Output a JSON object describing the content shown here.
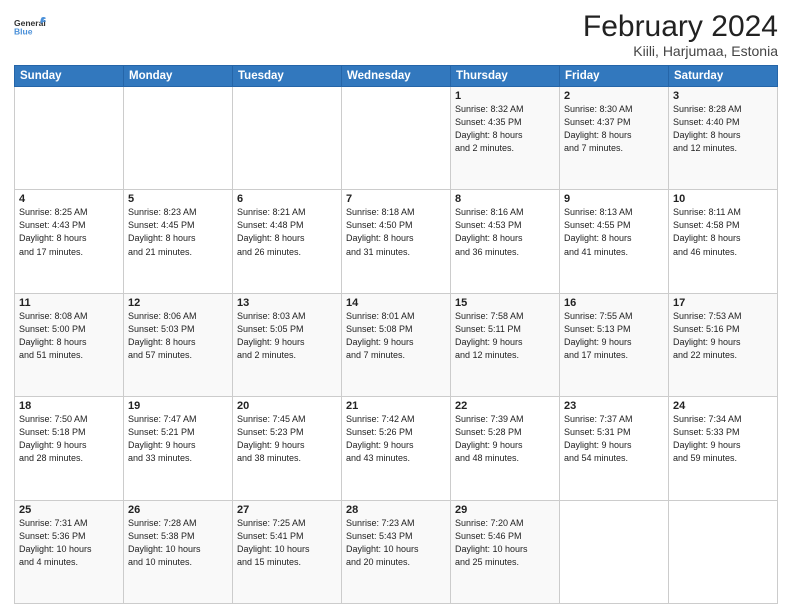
{
  "logo": {
    "line1": "General",
    "line2": "Blue"
  },
  "title": "February 2024",
  "subtitle": "Kiili, Harjumaa, Estonia",
  "days_header": [
    "Sunday",
    "Monday",
    "Tuesday",
    "Wednesday",
    "Thursday",
    "Friday",
    "Saturday"
  ],
  "weeks": [
    [
      {
        "num": "",
        "info": ""
      },
      {
        "num": "",
        "info": ""
      },
      {
        "num": "",
        "info": ""
      },
      {
        "num": "",
        "info": ""
      },
      {
        "num": "1",
        "info": "Sunrise: 8:32 AM\nSunset: 4:35 PM\nDaylight: 8 hours\nand 2 minutes."
      },
      {
        "num": "2",
        "info": "Sunrise: 8:30 AM\nSunset: 4:37 PM\nDaylight: 8 hours\nand 7 minutes."
      },
      {
        "num": "3",
        "info": "Sunrise: 8:28 AM\nSunset: 4:40 PM\nDaylight: 8 hours\nand 12 minutes."
      }
    ],
    [
      {
        "num": "4",
        "info": "Sunrise: 8:25 AM\nSunset: 4:43 PM\nDaylight: 8 hours\nand 17 minutes."
      },
      {
        "num": "5",
        "info": "Sunrise: 8:23 AM\nSunset: 4:45 PM\nDaylight: 8 hours\nand 21 minutes."
      },
      {
        "num": "6",
        "info": "Sunrise: 8:21 AM\nSunset: 4:48 PM\nDaylight: 8 hours\nand 26 minutes."
      },
      {
        "num": "7",
        "info": "Sunrise: 8:18 AM\nSunset: 4:50 PM\nDaylight: 8 hours\nand 31 minutes."
      },
      {
        "num": "8",
        "info": "Sunrise: 8:16 AM\nSunset: 4:53 PM\nDaylight: 8 hours\nand 36 minutes."
      },
      {
        "num": "9",
        "info": "Sunrise: 8:13 AM\nSunset: 4:55 PM\nDaylight: 8 hours\nand 41 minutes."
      },
      {
        "num": "10",
        "info": "Sunrise: 8:11 AM\nSunset: 4:58 PM\nDaylight: 8 hours\nand 46 minutes."
      }
    ],
    [
      {
        "num": "11",
        "info": "Sunrise: 8:08 AM\nSunset: 5:00 PM\nDaylight: 8 hours\nand 51 minutes."
      },
      {
        "num": "12",
        "info": "Sunrise: 8:06 AM\nSunset: 5:03 PM\nDaylight: 8 hours\nand 57 minutes."
      },
      {
        "num": "13",
        "info": "Sunrise: 8:03 AM\nSunset: 5:05 PM\nDaylight: 9 hours\nand 2 minutes."
      },
      {
        "num": "14",
        "info": "Sunrise: 8:01 AM\nSunset: 5:08 PM\nDaylight: 9 hours\nand 7 minutes."
      },
      {
        "num": "15",
        "info": "Sunrise: 7:58 AM\nSunset: 5:11 PM\nDaylight: 9 hours\nand 12 minutes."
      },
      {
        "num": "16",
        "info": "Sunrise: 7:55 AM\nSunset: 5:13 PM\nDaylight: 9 hours\nand 17 minutes."
      },
      {
        "num": "17",
        "info": "Sunrise: 7:53 AM\nSunset: 5:16 PM\nDaylight: 9 hours\nand 22 minutes."
      }
    ],
    [
      {
        "num": "18",
        "info": "Sunrise: 7:50 AM\nSunset: 5:18 PM\nDaylight: 9 hours\nand 28 minutes."
      },
      {
        "num": "19",
        "info": "Sunrise: 7:47 AM\nSunset: 5:21 PM\nDaylight: 9 hours\nand 33 minutes."
      },
      {
        "num": "20",
        "info": "Sunrise: 7:45 AM\nSunset: 5:23 PM\nDaylight: 9 hours\nand 38 minutes."
      },
      {
        "num": "21",
        "info": "Sunrise: 7:42 AM\nSunset: 5:26 PM\nDaylight: 9 hours\nand 43 minutes."
      },
      {
        "num": "22",
        "info": "Sunrise: 7:39 AM\nSunset: 5:28 PM\nDaylight: 9 hours\nand 48 minutes."
      },
      {
        "num": "23",
        "info": "Sunrise: 7:37 AM\nSunset: 5:31 PM\nDaylight: 9 hours\nand 54 minutes."
      },
      {
        "num": "24",
        "info": "Sunrise: 7:34 AM\nSunset: 5:33 PM\nDaylight: 9 hours\nand 59 minutes."
      }
    ],
    [
      {
        "num": "25",
        "info": "Sunrise: 7:31 AM\nSunset: 5:36 PM\nDaylight: 10 hours\nand 4 minutes."
      },
      {
        "num": "26",
        "info": "Sunrise: 7:28 AM\nSunset: 5:38 PM\nDaylight: 10 hours\nand 10 minutes."
      },
      {
        "num": "27",
        "info": "Sunrise: 7:25 AM\nSunset: 5:41 PM\nDaylight: 10 hours\nand 15 minutes."
      },
      {
        "num": "28",
        "info": "Sunrise: 7:23 AM\nSunset: 5:43 PM\nDaylight: 10 hours\nand 20 minutes."
      },
      {
        "num": "29",
        "info": "Sunrise: 7:20 AM\nSunset: 5:46 PM\nDaylight: 10 hours\nand 25 minutes."
      },
      {
        "num": "",
        "info": ""
      },
      {
        "num": "",
        "info": ""
      }
    ]
  ]
}
